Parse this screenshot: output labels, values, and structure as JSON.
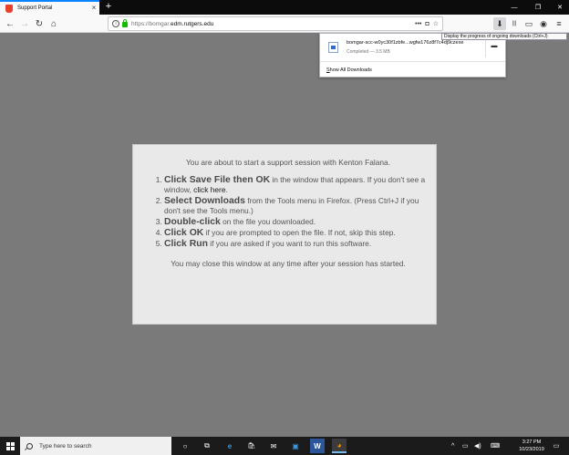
{
  "browser": {
    "tab": {
      "title": "Support Portal",
      "close": "×"
    },
    "new_tab": "+",
    "window_controls": {
      "minimize": "—",
      "maximize": "❐",
      "close": "✕"
    },
    "nav": {
      "back": "←",
      "forward": "→",
      "reload": "↻",
      "home": "⌂"
    },
    "url": {
      "prefix": "https://bomgar.",
      "host": "edm.rutgers.edu"
    },
    "url_actions": {
      "more": "•••",
      "pocket": "◘",
      "bookmark": "☆"
    },
    "toolbar": {
      "downloads": "⬇",
      "library": "|||",
      "sidebar": "▭",
      "extension": "◉",
      "menu": "≡"
    },
    "tooltip": "Display the progress of ongoing downloads (Ctrl+J)"
  },
  "downloads_panel": {
    "item": {
      "filename": "bomgar-scc-w0yc30f1zbfe...wgfw176z8f7c4dj9czexe",
      "status": "Completed — 3.5 MB"
    },
    "show_all": "Show All Downloads",
    "show_all_accel": "S",
    "show_all_rest": "how All Downloads"
  },
  "content": {
    "intro": "You are about to start a support session with Kenton Falana.",
    "steps": [
      {
        "strong": "Click Save File then OK",
        "text": " in the window that appears. If you don't see a window, ",
        "link": "click here",
        "tail": "."
      },
      {
        "strong": "Select Downloads",
        "text": " from the Tools menu in Firefox. (Press Ctrl+J if you don't see the Tools menu.)"
      },
      {
        "strong": "Double-click",
        "text": " on the file you downloaded."
      },
      {
        "strong": "Click OK",
        "text": " if you are prompted to open the file. If not, skip this step."
      },
      {
        "strong": "Click Run",
        "text": " if you are asked if you want to run this software."
      }
    ],
    "footer": "You may close this window at any time after your session has started."
  },
  "taskbar": {
    "search_placeholder": "Type here to search",
    "apps": [
      "○",
      "⧉",
      "e",
      "🛍",
      "✉",
      "▣",
      "W",
      "◕"
    ],
    "tray": {
      "chevron": "^",
      "network": "▭",
      "volume": "◀)",
      "keyboard": "⌨"
    },
    "clock": {
      "time": "3:27 PM",
      "date": "10/23/2019"
    },
    "notifications": "▭"
  },
  "colors": {
    "accent": "#0a84ff",
    "page_bg": "#7a7a7a",
    "card_bg": "#e9e9e9",
    "taskbar": "#1b1b1b"
  }
}
